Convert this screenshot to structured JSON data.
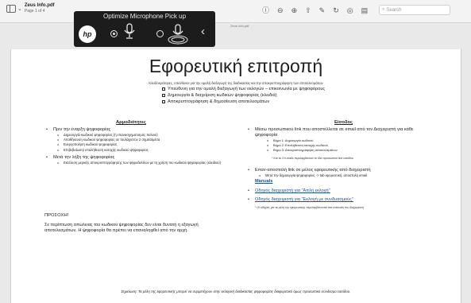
{
  "toolbar": {
    "doc_name": "Zeus Info.pdf",
    "doc_pages": "Page 1 of 4",
    "search_placeholder": "Search",
    "overlay_doc_title": "Zeus Info.pdf"
  },
  "mic_overlay": {
    "title": "Optimize Microphone Pick up",
    "logo": "hp",
    "options": [
      {
        "name": "personal-mic-option",
        "selected": true
      },
      {
        "name": "conference-mic-option",
        "selected": false
      }
    ]
  },
  "page": {
    "title": "Εφορευτική επιτροπή",
    "subtitle": "Κλειδοκράτορες, υπεύθυνοι για την ομαλή διεξαγωγή της διαδικασίας και την αποκρυπτογράφηση των αποτελεσμάτων",
    "checklist": [
      "Υπεύθυνη για την ομαλή διεξαγωγή των εκλογών – επικοινωνία με ψηφοφόρους",
      "Δημιουργία & διαχείριση κωδικών ψηφοφορίας (κλειδιά)",
      "Αποκρυπτογράφηση & δημοσίευση αποτελεσμάτων"
    ],
    "left_heading": "Αρμοδιότητες",
    "right_heading": "Είσοδος",
    "left_sections": [
      {
        "title": "Πριν την έναρξη ψηφοφορίας",
        "items": [
          "Δημιουργία κωδικού ψηφοφορίας (ή επανασχηματισμός παλιού)",
          "Αποθήκευση κωδικού ψηφοφορίας σε τουλάχιστον 2 σημεία/μέσα",
          "Ενεργοποίηση κωδικού ψηφοφορίας",
          "Επιβεβαίωση/ επαλήθευση κατοχής κωδικού ψηφοφορίας"
        ]
      },
      {
        "title": "Μετά την λήξη της ψηφοφορίας",
        "items": [
          "Εκτέλεση μερικής αποκρυπτογράφησης των ψηφοδελτίων με τη χρήση του κωδικού ψηφοφορίας (κλειδιού)"
        ]
      }
    ],
    "warning_heading": "ΠΡΟΣΟΧΗ!",
    "warning_text": "Σε περίπτωση απώλειας του κωδικού ψηφοφορίας δεν είναι δυνατή η εξαγωγή αποτελεσμάτων. Η ψηφοφορία θα πρέπει να επαναληφθεί από την αρχή.",
    "right_bullet_1": "Μέσω προσωπικού link που αποστέλλεται σε email από τον Διαχειριστή για κάθε ψηφοφορία",
    "steps": [
      "Βήμα 1: Δημιουργία κωδικού",
      "Βήμα 2: Επαλήθευση κατοχής κωδικού",
      "Βήμα 3: Αποκρυπτογράφηση αποτελεσμάτων"
    ],
    "step_note": "* Και τα 3 e-mails περιλαμβάνουν το ίδιο προσωπικό link εισόδου",
    "right_bullet_2": "Επαν-αποστολή link σε μέλος εφορευτικής από διαχειριστή",
    "right_bullet_2_sub": "Μετά την δημιουργία ψηφοφορίας -> tab εφορευτική, αποστολή email",
    "manuals_label": "Manuals",
    "link_1": "Οδηγός διαχειριστή για \"Απλή εκλογή\"",
    "link_2": "Οδηγός διαχειριστή για \"Εκλογή με συνδυασμούς\"",
    "manuals_note": "* Οι οδηγίες για τα μέλη της εφορευτικής περιλαμβάνονται στα manuals του διαχειριστή",
    "footer": "Σημείωση: Τα μέλη της εφορευτικής μπορεί να συμμετέχουν στην εκλογική διαδικασίας ψηφοφορίας διαφορετικό όμως προσωπικό σύνδεσμο εισόδου."
  }
}
